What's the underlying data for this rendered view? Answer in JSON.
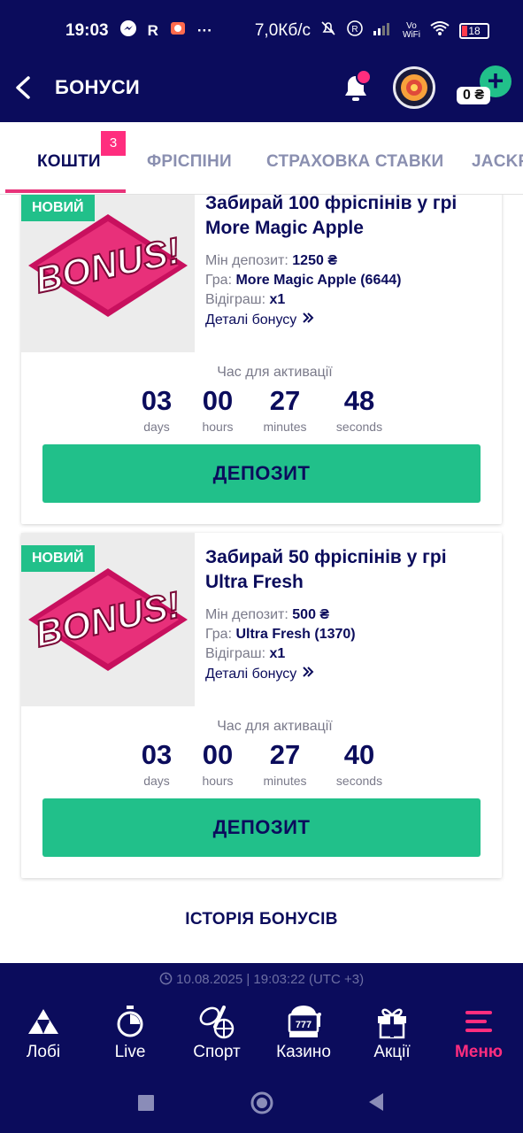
{
  "status_bar": {
    "time": "19:03",
    "left_icons": [
      "messenger-icon",
      "r-letter",
      "app-icon",
      "more-dots"
    ],
    "network_speed": "7,0Кб/с",
    "battery": "18",
    "wifi_label_top": "Vo",
    "wifi_label_bottom": "WiFi"
  },
  "header": {
    "title": "БОНУСИ",
    "balance": "0 ₴"
  },
  "tabs": [
    {
      "label": "КОШТИ",
      "badge": "3",
      "active": true
    },
    {
      "label": "ФРІСПІНИ"
    },
    {
      "label": "СТРАХОВКА СТАВКИ"
    },
    {
      "label": "JACKPOT"
    }
  ],
  "cards": [
    {
      "badge": "НОВИЙ",
      "title": "Забирай 100 фріспінів у грі More Magic Apple",
      "min_deposit_label": "Мін депозит:",
      "min_deposit_value": "1250 ₴",
      "game_label": "Гра:",
      "game_value": "More Magic Apple (6644)",
      "wager_label": "Відіграш:",
      "wager_value": "x1",
      "details_label": "Деталі бонусу",
      "timer_label": "Час для активації",
      "timer": {
        "days": "03",
        "hours": "00",
        "minutes": "27",
        "seconds": "48"
      },
      "button_label": "ДЕПОЗИТ"
    },
    {
      "badge": "НОВИЙ",
      "title": "Забирай 50 фріспінів у грі Ultra Fresh",
      "min_deposit_label": "Мін депозит:",
      "min_deposit_value": "500 ₴",
      "game_label": "Гра:",
      "game_value": "Ultra Fresh (1370)",
      "wager_label": "Відіграш:",
      "wager_value": "x1",
      "details_label": "Деталі бонусу",
      "timer_label": "Час для активації",
      "timer": {
        "days": "03",
        "hours": "00",
        "minutes": "27",
        "seconds": "40"
      },
      "button_label": "ДЕПОЗИТ"
    }
  ],
  "timer_units": {
    "days": "days",
    "hours": "hours",
    "minutes": "minutes",
    "seconds": "seconds"
  },
  "bonus_image_text": "BONUS!",
  "history_link": "ІСТОРІЯ БОНУСІВ",
  "footer": {
    "datetime": "10.08.2025 | 19:03:22 (UTC +3)",
    "nav": [
      {
        "label": "Лобі",
        "icon": "lobby-icon"
      },
      {
        "label": "Live",
        "icon": "stopwatch-icon"
      },
      {
        "label": "Спорт",
        "icon": "sport-icon"
      },
      {
        "label": "Казино",
        "icon": "slot-machine-icon"
      },
      {
        "label": "Акції",
        "icon": "gift-icon"
      },
      {
        "label": "Меню",
        "icon": "menu-icon",
        "active": true
      }
    ]
  },
  "colors": {
    "navy": "#0b0c5c",
    "green": "#21c08a",
    "pink": "#ff2d7e"
  }
}
